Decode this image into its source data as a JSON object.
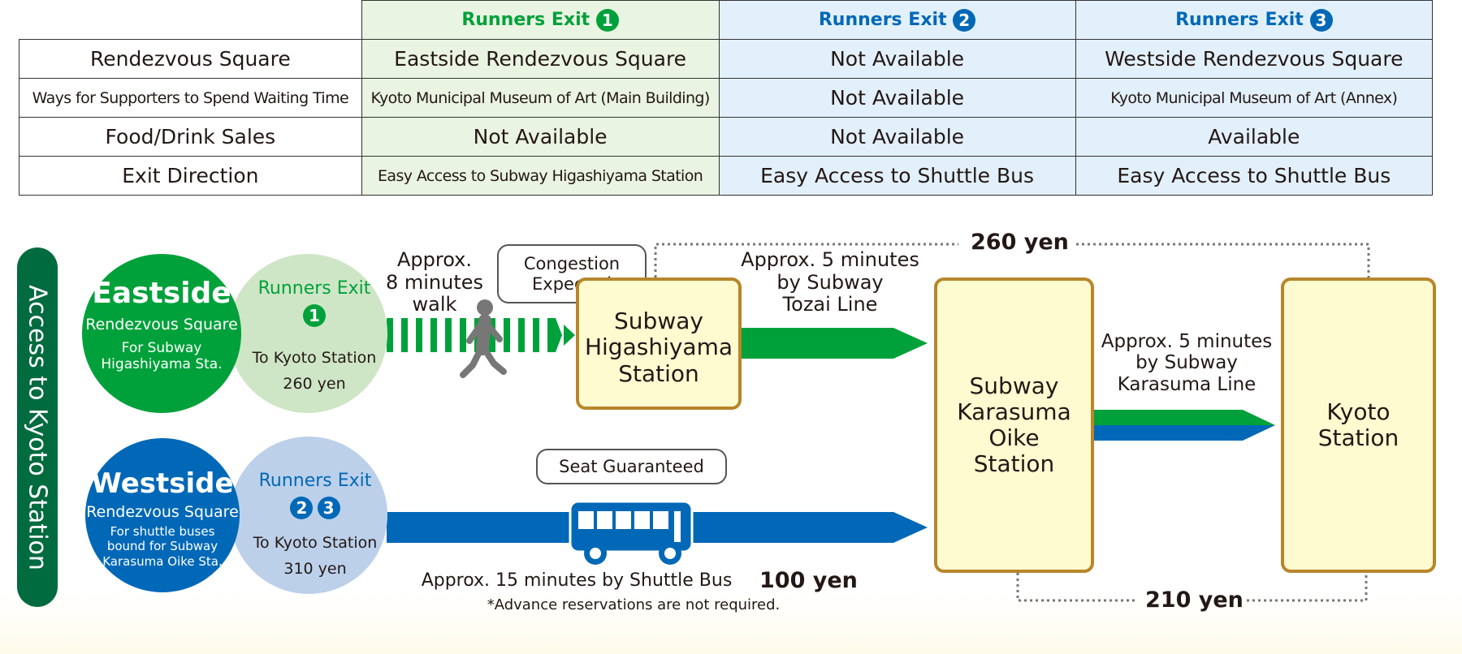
{
  "table": {
    "headers": [
      "",
      "Runners Exit",
      "Runners Exit",
      "Runners Exit"
    ],
    "header_numbers": [
      "1",
      "2",
      "3"
    ],
    "rows": [
      [
        "Rendezvous Square",
        "Eastside Rendezvous Square",
        "Not Available",
        "Westside Rendezvous Square"
      ],
      [
        "Ways for Supporters to Spend Waiting Time",
        "Kyoto Municipal Museum of Art (Main Building)",
        "Not Available",
        "Kyoto Municipal Museum of Art (Annex)"
      ],
      [
        "Food/Drink Sales",
        "Not Available",
        "Not Available",
        "Available"
      ],
      [
        "Exit Direction",
        "Easy Access to Subway Higashiyama Station",
        "Easy Access to Shuttle Bus",
        "Easy Access to Shuttle Bus"
      ]
    ]
  },
  "diagram": {
    "side_title": "Access to Kyoto Station",
    "east": {
      "title": "Eastside",
      "subtitle": "Rendezvous Square",
      "note": "For Subway\nHigashiyama Sta.",
      "exit_label": "Runners Exit",
      "exit_numbers": [
        "1"
      ],
      "to": "To Kyoto Station",
      "fare": "260 yen"
    },
    "west": {
      "title": "Westside",
      "subtitle": "Rendezvous Square",
      "note": "For shuttle buses\nbound for Subway\nKarasuma Oike Sta.",
      "exit_label": "Runners Exit",
      "exit_numbers": [
        "2",
        "3"
      ],
      "to": "To Kyoto Station",
      "fare": "310 yen"
    },
    "walk": "Approx.\n8 minutes\nwalk",
    "congestion": "Congestion\nExpected",
    "higashiyama": "Subway\nHigashiyama\nStation",
    "tozai": "Approx. 5 minutes\nby Subway\nTozai Line",
    "karasuma_oike": "Subway\nKarasuma\nOike\nStation",
    "karasuma_line": "Approx. 5 minutes\nby Subway\nKarasuma Line",
    "kyoto": "Kyoto\nStation",
    "seat": "Seat Guaranteed",
    "bus": "Approx. 15 minutes by Shuttle Bus",
    "bus_fare": "100 yen",
    "bus_note": "*Advance reservations are not required.",
    "fare_top": "260 yen",
    "fare_bottom": "210 yen"
  },
  "colors": {
    "green": "#00a13a",
    "blue": "#0068b7",
    "dark_green": "#006b3f",
    "station_border": "#b8862b",
    "station_fill": "#fffbd0"
  }
}
